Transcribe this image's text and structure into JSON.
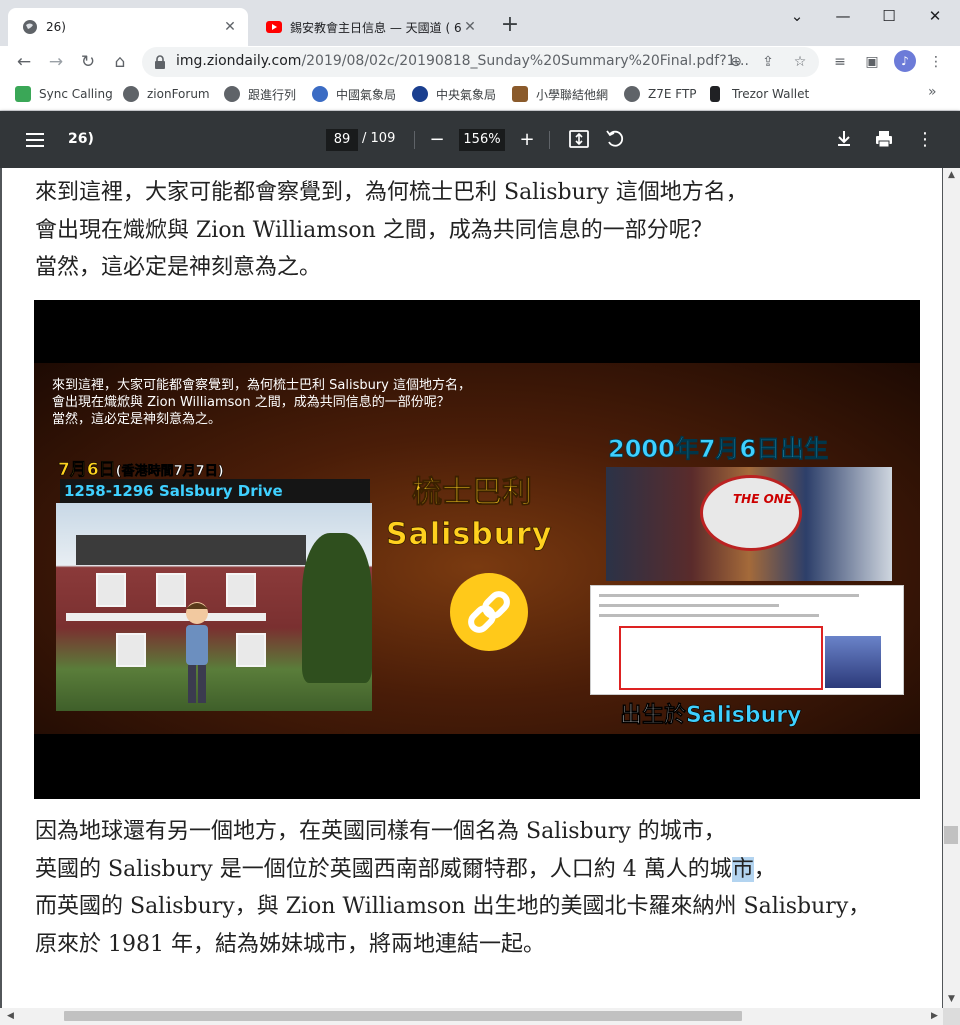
{
  "browser": {
    "tabs": [
      {
        "title": "26)",
        "active": true
      },
      {
        "title": "錫安教會主日信息 — 天國道 ( 6",
        "active": false
      }
    ],
    "url_host": "img.ziondaily.com",
    "url_path": "/2019/08/02c/20190818_Sunday%20Summary%20Final.pdf?1...",
    "bookmarks": [
      "Sync Calling",
      "zionForum",
      "跟進行列",
      "中國氣象局",
      "中央氣象局",
      "小學聯結他網",
      "Z7E FTP",
      "Trezor Wallet"
    ],
    "window_controls": [
      "minimize",
      "maximize",
      "close"
    ]
  },
  "pdf": {
    "title": "26)",
    "page_current": "89",
    "page_total": "109",
    "page_separator": "/",
    "zoom": "156%"
  },
  "content": {
    "para1": [
      "來到這裡，大家可能都會察覺到，為何梳士巴利 Salisbury 這個地方名，",
      "會出現在熾焮與 Zion Williamson 之間，成為共同信息的一部分呢？",
      "當然，這必定是神刻意為之。"
    ],
    "para2": [
      "因為地球還有另一個地方，在英國同樣有一個名為 Salisbury 的城市，",
      "英國的 Salisbury 是一個位於英國西南部威爾特郡，人口約 4 萬人的城",
      "市",
      "，",
      "而英國的 Salisbury，與 Zion Williamson 出生地的美國北卡羅來納州 Salisbury，",
      "原來於 1981 年，結為姊妹城市，將兩地連結一起。"
    ]
  },
  "slide": {
    "intro_lines": [
      "來到這裡，大家可能都會察覺到，為何梳士巴利 Salisbury 這個地方名，",
      "會出現在熾焮與 Zion Williamson 之間，成為共同信息的一部份呢？",
      "當然，這必定是神刻意為之。"
    ],
    "date_main": "7月6日",
    "date_note": "(香港時間7月7日)",
    "address": "1258-1296 Salsbury Drive",
    "center_cn": "梳士巴利",
    "center_en": "Salisbury",
    "birth_date": "2000年7月6日出生",
    "one_logo": "THE ONE",
    "born_prefix": "出生於",
    "born_place": "Salisbury",
    "colors": {
      "yellow": "#ffd11f",
      "cyan": "#3fd0ff"
    }
  }
}
